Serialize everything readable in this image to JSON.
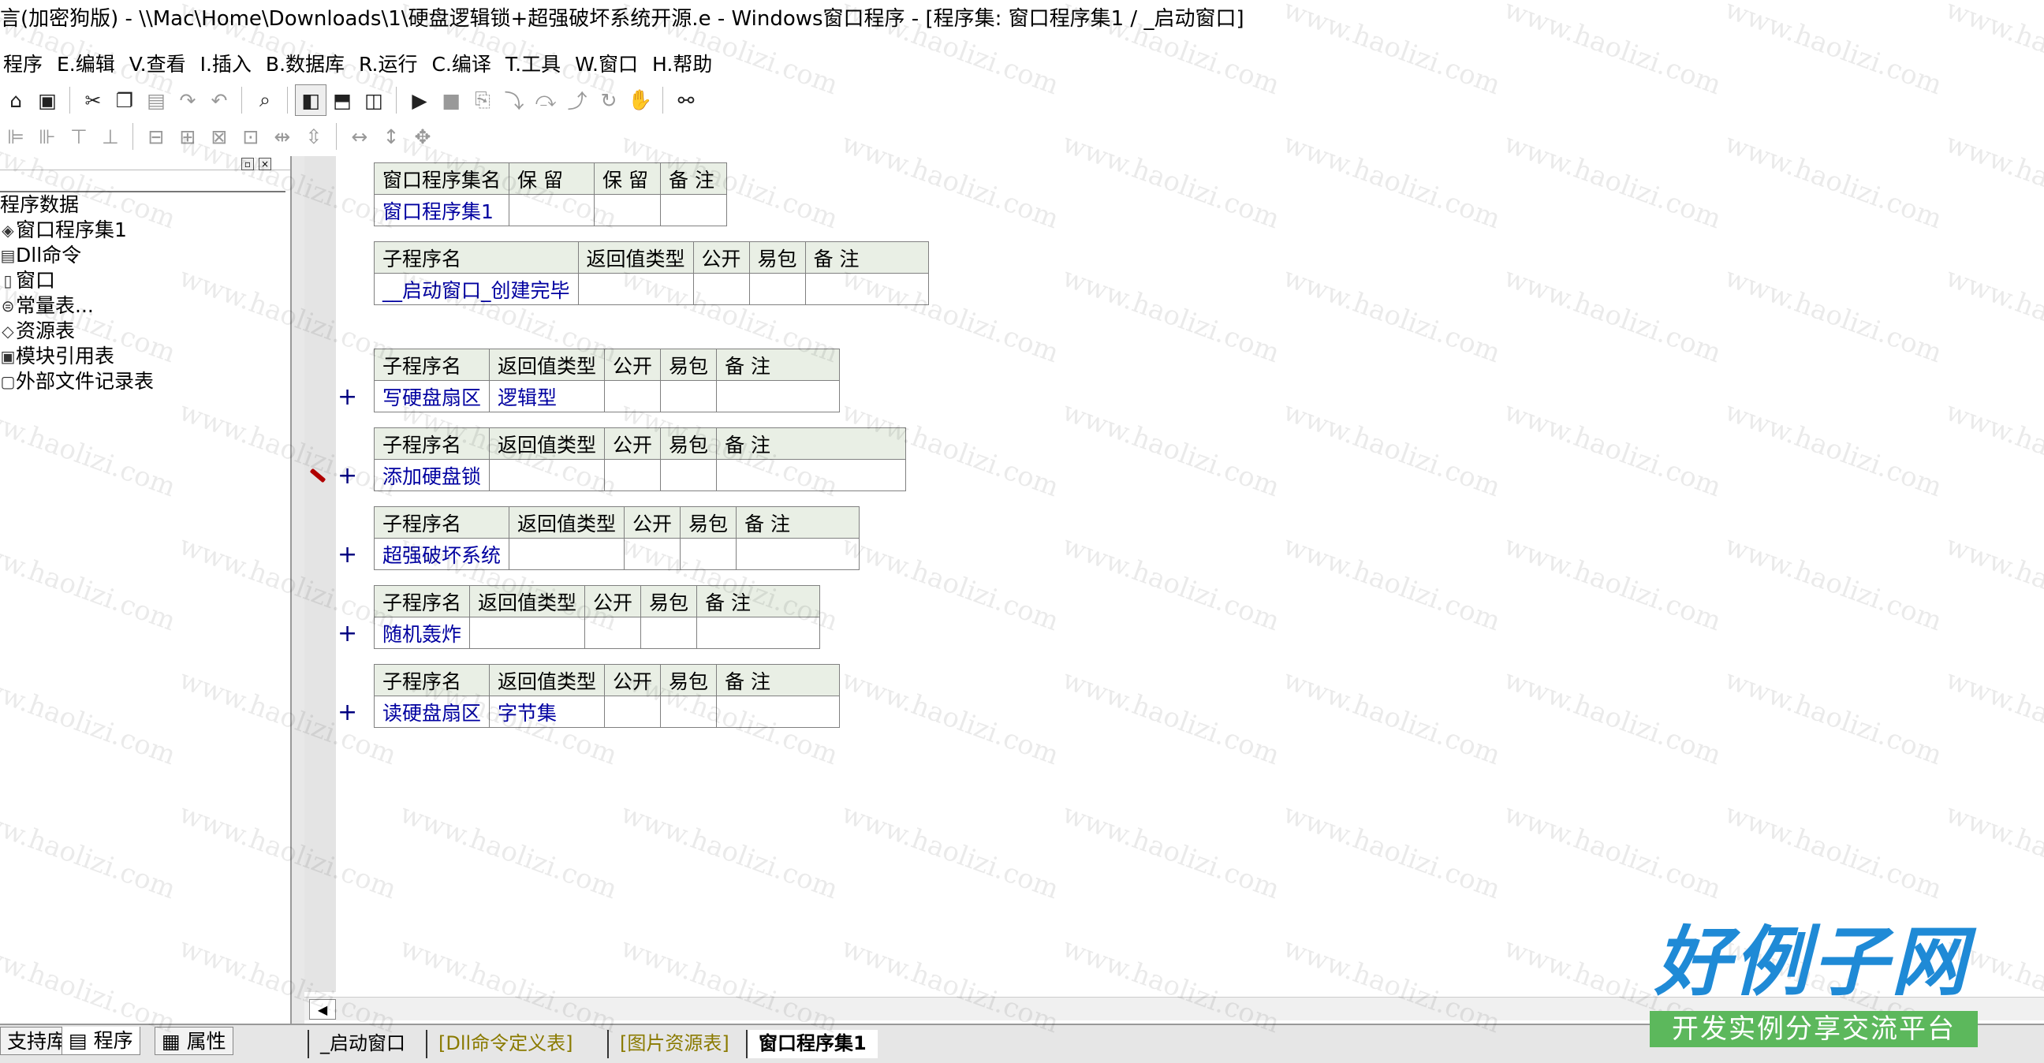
{
  "title": "言(加密狗版) - \\\\Mac\\Home\\Downloads\\1\\硬盘逻辑锁+超强破坏系统开源.e - Windows窗口程序 - [程序集: 窗口程序集1 / _启动窗口]",
  "menu": [
    "程序",
    "E.编辑",
    "V.查看",
    "I.插入",
    "B.数据库",
    "R.运行",
    "C.编译",
    "T.工具",
    "W.窗口",
    "H.帮助"
  ],
  "tree": {
    "root": "程序数据",
    "items": [
      "窗口程序集1",
      "Dll命令",
      "窗口",
      "常量表...",
      "资源表",
      "模块引用表",
      "外部文件记录表"
    ]
  },
  "assembly": {
    "headers": [
      "窗口程序集名",
      "保 留",
      "保 留",
      "备 注"
    ],
    "values": [
      "窗口程序集1",
      "",
      "",
      ""
    ]
  },
  "procs": [
    {
      "headers": [
        "子程序名",
        "返回值类型",
        "公开",
        "易包",
        "备 注"
      ],
      "values": [
        "__启动窗口_创建完毕",
        "",
        "",
        "",
        ""
      ]
    },
    {
      "headers": [
        "子程序名",
        "返回值类型",
        "公开",
        "易包",
        "备 注"
      ],
      "values": [
        "写硬盘扇区",
        "逻辑型",
        "",
        "",
        ""
      ]
    },
    {
      "headers": [
        "子程序名",
        "返回值类型",
        "公开",
        "易包",
        "备 注"
      ],
      "values": [
        "添加硬盘锁",
        "",
        "",
        "",
        ""
      ]
    },
    {
      "headers": [
        "子程序名",
        "返回值类型",
        "公开",
        "易包",
        "备 注"
      ],
      "values": [
        "超强破坏系统",
        "",
        "",
        "",
        ""
      ]
    },
    {
      "headers": [
        "子程序名",
        "返回值类型",
        "公开",
        "易包",
        "备 注"
      ],
      "values": [
        "随机轰炸",
        "",
        "",
        "",
        ""
      ]
    },
    {
      "headers": [
        "子程序名",
        "返回值类型",
        "公开",
        "易包",
        "备 注"
      ],
      "values": [
        "读硬盘扇区",
        "字节集",
        "",
        "",
        ""
      ]
    }
  ],
  "plus": "+",
  "bottom_left_tabs": [
    "支持库",
    "程序",
    "属性"
  ],
  "editor_tabs": [
    "_启动窗口",
    "[Dll命令定义表]",
    "[图片资源表]",
    "窗口程序集1"
  ],
  "watermark": "www.haolizi.com",
  "brand": {
    "title": "好例子网",
    "subtitle": "开发实例分享交流平台"
  },
  "colors": {
    "header_bg": "#e9efe5",
    "value_text": "#0000a0",
    "brand_blue": "#1f8ad6",
    "brand_green": "#5cb85c"
  }
}
